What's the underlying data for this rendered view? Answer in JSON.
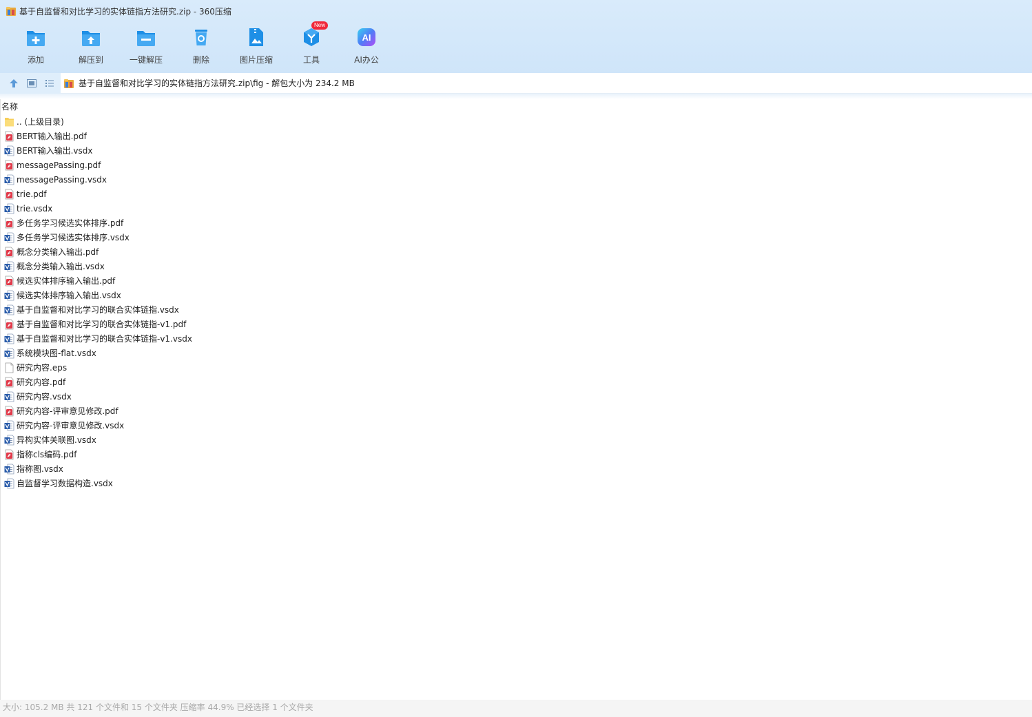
{
  "window": {
    "title": "基于自监督和对比学习的实体链指方法研究.zip - 360压缩"
  },
  "toolbar": {
    "items": [
      {
        "label": "添加",
        "icon": "folder-add-icon"
      },
      {
        "label": "解压到",
        "icon": "extract-to-icon"
      },
      {
        "label": "一键解压",
        "icon": "one-click-extract-icon"
      },
      {
        "label": "删除",
        "icon": "delete-icon"
      },
      {
        "label": "图片压缩",
        "icon": "image-compress-icon"
      },
      {
        "label": "工具",
        "icon": "tools-icon",
        "badge": "New"
      },
      {
        "label": "AI办公",
        "icon": "ai-office-icon"
      }
    ]
  },
  "address": {
    "path": "基于自监督和对比学习的实体链指方法研究.zip\\fig - 解包大小为 234.2 MB"
  },
  "list": {
    "column_name": "名称",
    "files": [
      {
        "name": ".. (上级目录)",
        "type": "folder"
      },
      {
        "name": "BERT输入输出.pdf",
        "type": "pdf"
      },
      {
        "name": "BERT输入输出.vsdx",
        "type": "vsdx"
      },
      {
        "name": "messagePassing.pdf",
        "type": "pdf"
      },
      {
        "name": "messagePassing.vsdx",
        "type": "vsdx"
      },
      {
        "name": "trie.pdf",
        "type": "pdf"
      },
      {
        "name": "trie.vsdx",
        "type": "vsdx"
      },
      {
        "name": "多任务学习候选实体排序.pdf",
        "type": "pdf"
      },
      {
        "name": "多任务学习候选实体排序.vsdx",
        "type": "vsdx"
      },
      {
        "name": "概念分类输入输出.pdf",
        "type": "pdf"
      },
      {
        "name": "概念分类输入输出.vsdx",
        "type": "vsdx"
      },
      {
        "name": "候选实体排序输入输出.pdf",
        "type": "pdf"
      },
      {
        "name": "候选实体排序输入输出.vsdx",
        "type": "vsdx"
      },
      {
        "name": "基于自监督和对比学习的联合实体链指.vsdx",
        "type": "vsdx"
      },
      {
        "name": "基于自监督和对比学习的联合实体链指-v1.pdf",
        "type": "pdf"
      },
      {
        "name": "基于自监督和对比学习的联合实体链指-v1.vsdx",
        "type": "vsdx"
      },
      {
        "name": "系统模块图-flat.vsdx",
        "type": "vsdx"
      },
      {
        "name": "研究内容.eps",
        "type": "blank"
      },
      {
        "name": "研究内容.pdf",
        "type": "pdf"
      },
      {
        "name": "研究内容.vsdx",
        "type": "vsdx"
      },
      {
        "name": "研究内容-评审意见修改.pdf",
        "type": "pdf"
      },
      {
        "name": "研究内容-评审意见修改.vsdx",
        "type": "vsdx"
      },
      {
        "name": "异构实体关联图.vsdx",
        "type": "vsdx"
      },
      {
        "name": "指称cls编码.pdf",
        "type": "pdf"
      },
      {
        "name": "指称图.vsdx",
        "type": "vsdx"
      },
      {
        "name": "自监督学习数据构造.vsdx",
        "type": "vsdx"
      }
    ]
  },
  "status": {
    "text": "大小: 105.2 MB 共 121 个文件和 15 个文件夹 压缩率 44.9% 已经选择 1 个文件夹"
  },
  "colors": {
    "title_bg": "#d9ebfb",
    "toolbar_blue": "#1e8fe6",
    "pdf_red": "#e23a4a",
    "vsdx_blue": "#2a5caa",
    "new_badge": "#f0283a",
    "status_text": "#a8a8a8"
  }
}
